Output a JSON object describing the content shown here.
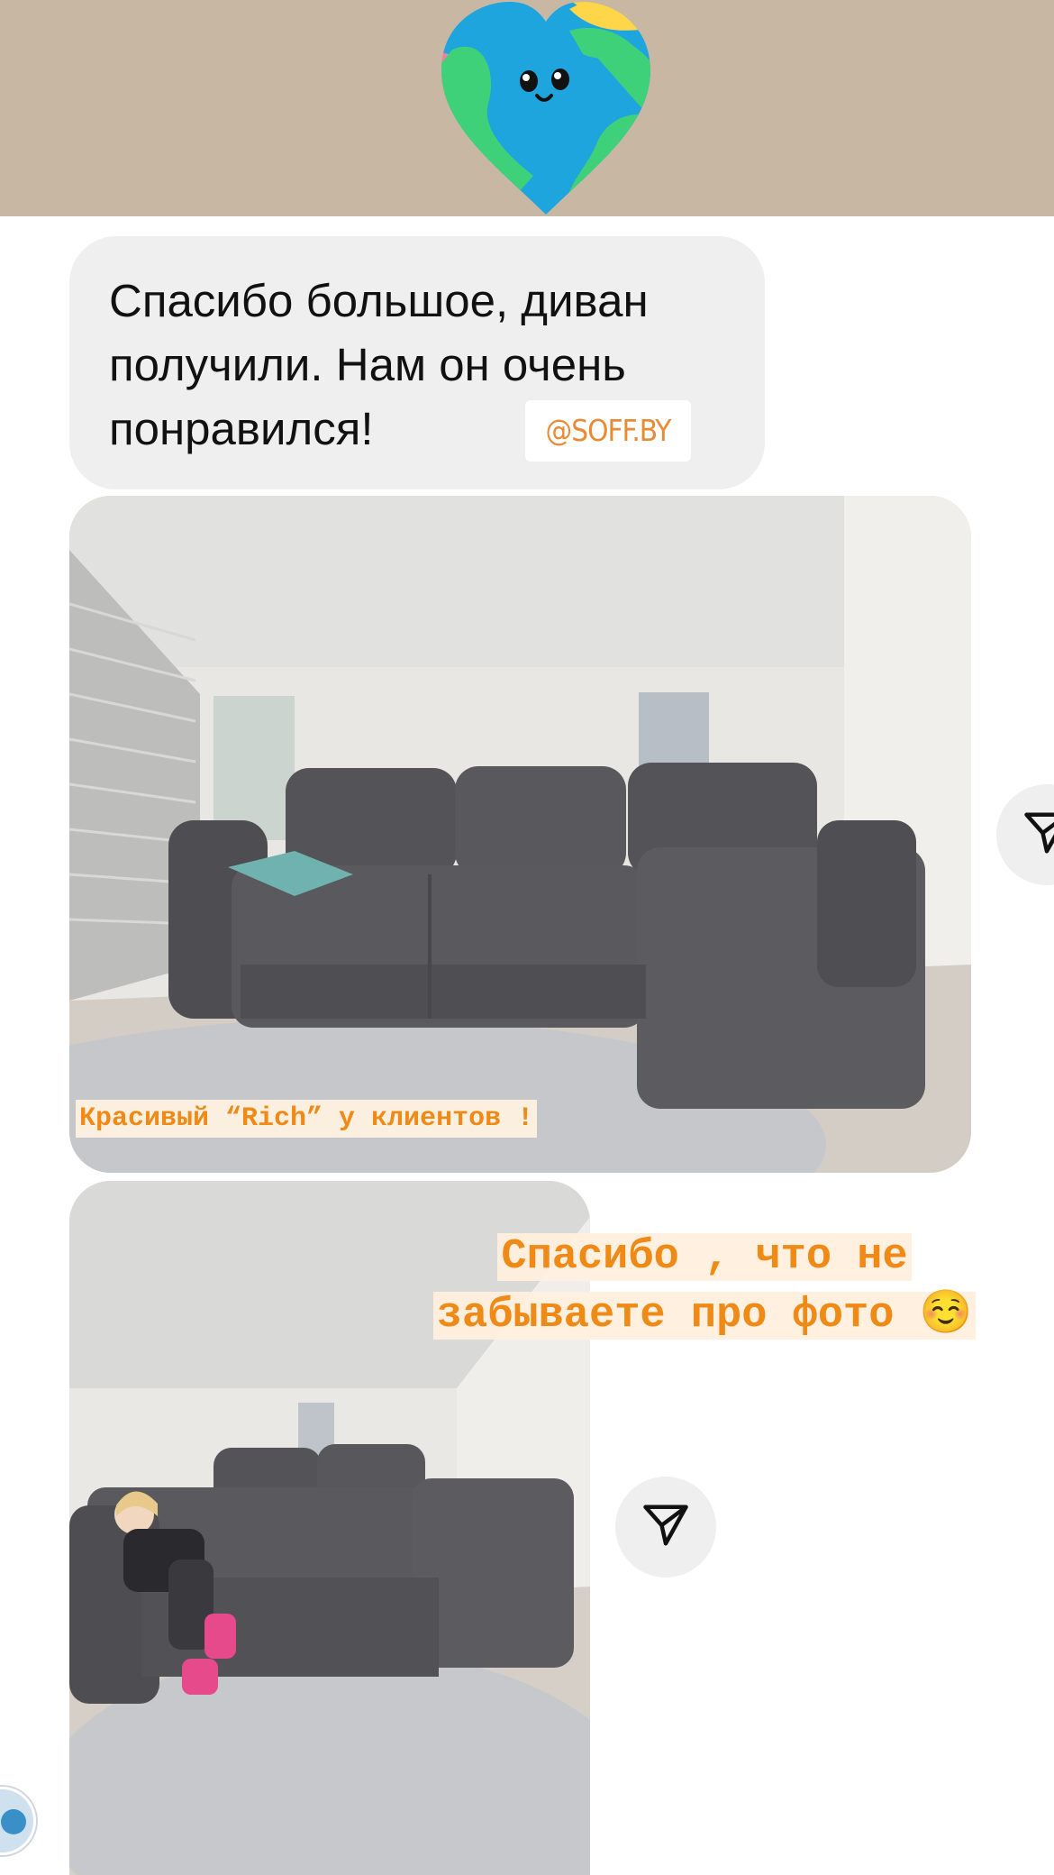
{
  "message": {
    "text": "Спасибо большое, диван\nполучили. Нам он очень\nпонравился!",
    "mention": "@SOFF.BY"
  },
  "photos": [
    {
      "caption": "Красивый “Rich” у клиентов !"
    },
    {
      "caption_lines": [
        "Спасибо , что не",
        "забываете про фото ☺️"
      ]
    }
  ],
  "icons": {
    "sticker": "earth-heart-sticker-icon",
    "share": "paper-plane-icon",
    "avatar": "avatar"
  },
  "colors": {
    "banner": "#c8b7a3",
    "bubble": "#efefef",
    "caption_text": "#ef8a17",
    "mention_text": "#e98b35"
  }
}
